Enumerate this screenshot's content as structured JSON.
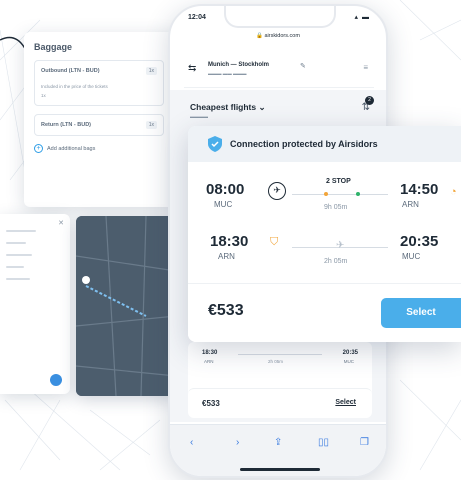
{
  "baggage": {
    "title": "Baggage",
    "outbound_label": "Outbound (LTN - BUD)",
    "outbound_badge": "1x",
    "included_note": "Included in the price of the tickets",
    "included_item": "1x",
    "return_label": "Return (LTN - BUD)",
    "return_badge": "1x",
    "add_label": "Add additional bags"
  },
  "phone": {
    "status_time": "12:04",
    "url": "airskidors.com",
    "route_title": "Munich — Stockholm",
    "sort_title": "Cheapest flights",
    "filter_count": "2"
  },
  "flight_card": {
    "protection_text": "Connection protected by Airsidors",
    "outbound": {
      "depart_time": "08:00",
      "depart_code": "MUC",
      "stops": "2 STOP",
      "duration": "9h 05m",
      "arrive_time": "14:50",
      "arrive_code": "ARN"
    },
    "return": {
      "depart_time": "18:30",
      "depart_code": "ARN",
      "duration": "2h 05m",
      "arrive_time": "20:35",
      "arrive_code": "MUC"
    },
    "price": "€533",
    "select_label": "Select"
  },
  "second_result": {
    "depart_time": "18:30",
    "depart_code": "ARN",
    "duration": "2h 05m",
    "arrive_time": "20:35",
    "arrive_code": "MUC",
    "price": "€533",
    "select_label": "Select"
  },
  "colors": {
    "accent_blue": "#4aaeea",
    "warning_orange": "#f2a53a",
    "stop_green": "#2fb36b",
    "dark_text": "#1e2a36"
  }
}
